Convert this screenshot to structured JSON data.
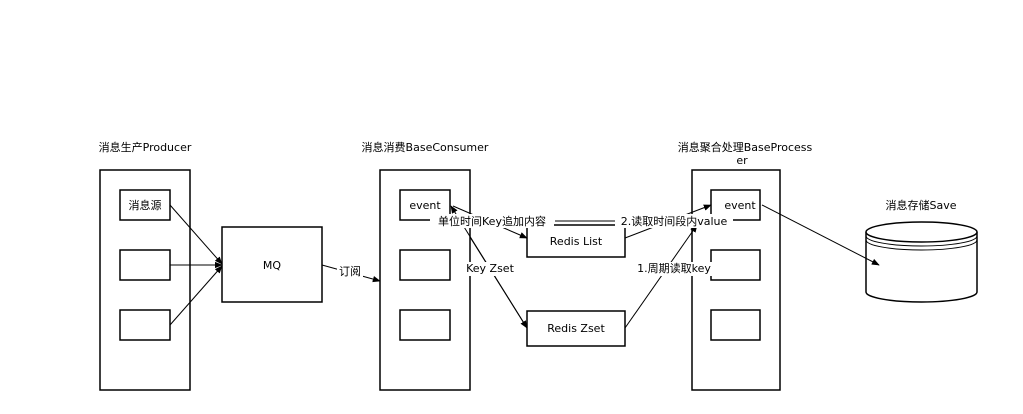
{
  "groups": {
    "producer": {
      "title": "消息生产Producer",
      "items": [
        "消息源",
        "",
        ""
      ]
    },
    "consumer": {
      "title": "消息消费BaseConsumer",
      "items": [
        "event",
        "",
        ""
      ]
    },
    "processor": {
      "title_line1": "消息聚合处理BaseProcess",
      "title_line2": "er",
      "items": [
        "event",
        "",
        ""
      ]
    },
    "storage": {
      "title": "消息存储Save"
    }
  },
  "nodes": {
    "mq": "MQ",
    "redis_list": "Redis List",
    "redis_zset": "Redis Zset"
  },
  "edges": {
    "subscribe": "订阅",
    "append": "单位时间Key追加内容",
    "key_zset": "Key Zset",
    "read_value": "2.读取时间段内value",
    "read_key": "1.周期读取key"
  }
}
